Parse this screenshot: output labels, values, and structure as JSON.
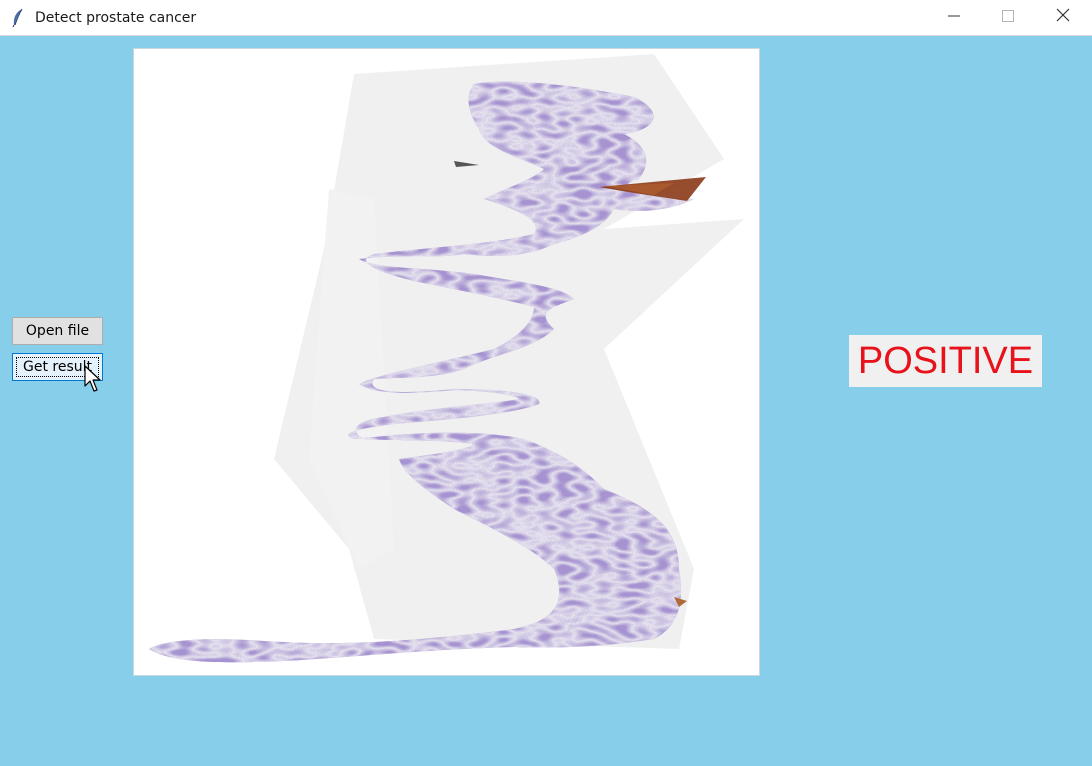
{
  "window": {
    "title": "Detect prostate cancer",
    "background_color": "#87CEEB",
    "controls": {
      "minimize_icon": "minimize-icon",
      "maximize_icon": "maximize-icon",
      "close_icon": "close-icon"
    }
  },
  "buttons": {
    "open_file_label": "Open file",
    "get_result_label": "Get result"
  },
  "image_panel": {
    "content": "prostate tissue histology slide",
    "stain_color": "#9b86cc"
  },
  "result": {
    "text": "POSITIVE",
    "color": "#e8121a"
  }
}
